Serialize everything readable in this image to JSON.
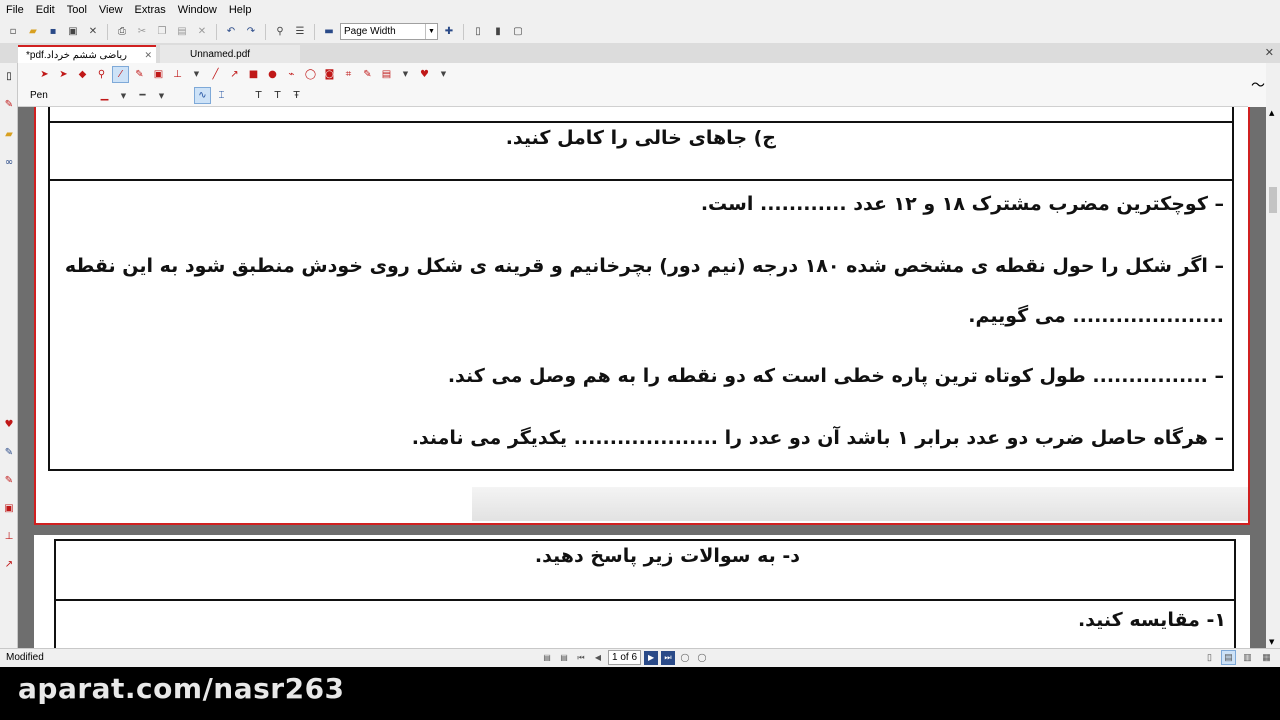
{
  "menu": [
    "File",
    "Edit",
    "Tool",
    "View",
    "Extras",
    "Window",
    "Help"
  ],
  "toolbar": {
    "zoom_value": "Page Width"
  },
  "tabs": [
    {
      "label": "ریاضی ششم خرداد.pdf*",
      "close": "✕"
    },
    {
      "label": "Unnamed.pdf"
    }
  ],
  "annotation": {
    "tool_label": "Pen"
  },
  "page1": {
    "heading": "ج) جاهای خالی را کامل کنید.",
    "line1": "– کوچکترین مضرب مشترک ۱۸ و ۱۲ عدد ............ است.",
    "line2a": "– اگر شکل را حول نقطه ی مشخص شده ۱۸۰ درجه (نیم دور) بچرخانیم و قرینه ی شکل روی خودش منطبق شود به این نقطه",
    "line2b": "..................... می گوییم.",
    "line3": "– ................ طول کوتاه ترین پاره خطی است که دو نقطه را به هم وصل می کند.",
    "line4": "– هرگاه حاصل ضرب دو عدد برابر ۱ باشد آن دو عدد را .................... یکدیگر می نامند."
  },
  "page2": {
    "heading": "د- به سوالات زیر پاسخ دهید.",
    "q1": "۱- مقایسه کنید."
  },
  "status": {
    "text": "Modified",
    "page_indicator": "1 of 6"
  },
  "watermark": "aparat.com/nasr263",
  "icons": {
    "sig": "〜",
    "heart": "♥"
  }
}
